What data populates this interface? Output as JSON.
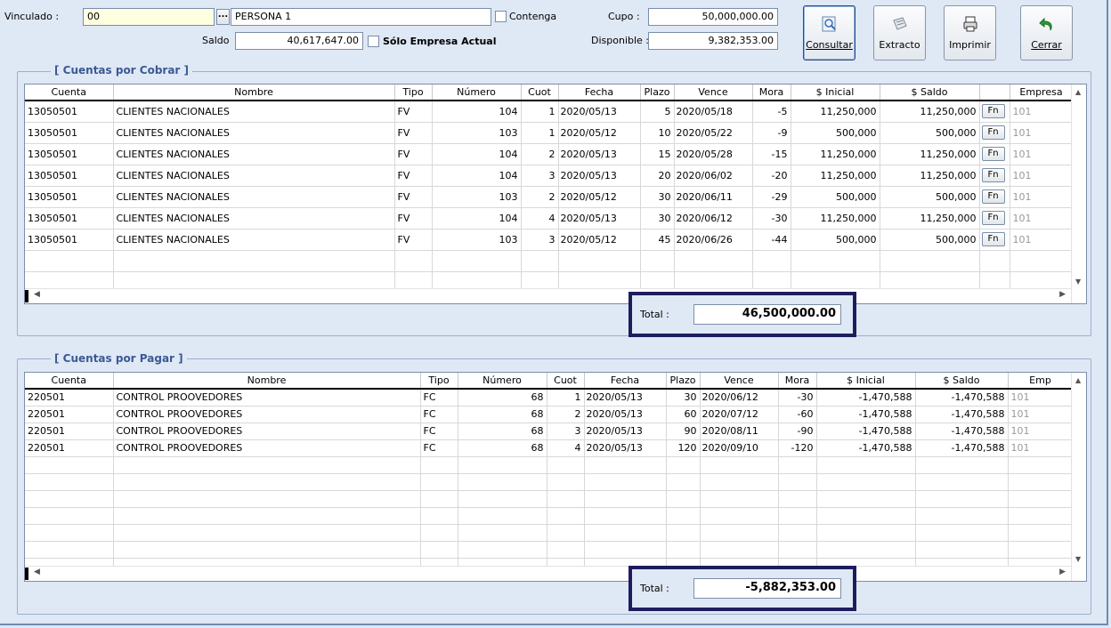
{
  "header": {
    "vinculado_label": "Vinculado :",
    "vinculado_value": "00",
    "dots_label": "...",
    "persona_value": "PERSONA 1",
    "contenga_label": "Contenga",
    "saldo_label": "Saldo",
    "saldo_value": "40,617,647.00",
    "solo_empresa_label": "Sólo Empresa Actual",
    "cupo_label": "Cupo :",
    "cupo_value": "50,000,000.00",
    "disponible_label": "Disponible :",
    "disponible_value": "9,382,353.00"
  },
  "toolbar": {
    "consultar": "Consultar",
    "extracto": "Extracto",
    "imprimir": "Imprimir",
    "cerrar": "Cerrar"
  },
  "cobrar": {
    "title": "[ Cuentas por Cobrar ]",
    "columns": [
      "Cuenta",
      "Nombre",
      "Tipo",
      "Número",
      "Cuot",
      "Fecha",
      "Plazo",
      "Vence",
      "Mora",
      "$ Inicial",
      "$ Saldo",
      "",
      "Empresa"
    ],
    "rows": [
      {
        "cuenta": "13050501",
        "nombre": "CLIENTES NACIONALES",
        "tipo": "FV",
        "numero": "104",
        "cuot": "1",
        "fecha": "2020/05/13",
        "plazo": "5",
        "vence": "2020/05/18",
        "mora": "-5",
        "inicial": "11,250,000",
        "saldo": "11,250,000",
        "fn": "Fn",
        "empresa": "101"
      },
      {
        "cuenta": "13050501",
        "nombre": "CLIENTES NACIONALES",
        "tipo": "FV",
        "numero": "103",
        "cuot": "1",
        "fecha": "2020/05/12",
        "plazo": "10",
        "vence": "2020/05/22",
        "mora": "-9",
        "inicial": "500,000",
        "saldo": "500,000",
        "fn": "Fn",
        "empresa": "101"
      },
      {
        "cuenta": "13050501",
        "nombre": "CLIENTES NACIONALES",
        "tipo": "FV",
        "numero": "104",
        "cuot": "2",
        "fecha": "2020/05/13",
        "plazo": "15",
        "vence": "2020/05/28",
        "mora": "-15",
        "inicial": "11,250,000",
        "saldo": "11,250,000",
        "fn": "Fn",
        "empresa": "101"
      },
      {
        "cuenta": "13050501",
        "nombre": "CLIENTES NACIONALES",
        "tipo": "FV",
        "numero": "104",
        "cuot": "3",
        "fecha": "2020/05/13",
        "plazo": "20",
        "vence": "2020/06/02",
        "mora": "-20",
        "inicial": "11,250,000",
        "saldo": "11,250,000",
        "fn": "Fn",
        "empresa": "101"
      },
      {
        "cuenta": "13050501",
        "nombre": "CLIENTES NACIONALES",
        "tipo": "FV",
        "numero": "103",
        "cuot": "2",
        "fecha": "2020/05/12",
        "plazo": "30",
        "vence": "2020/06/11",
        "mora": "-29",
        "inicial": "500,000",
        "saldo": "500,000",
        "fn": "Fn",
        "empresa": "101"
      },
      {
        "cuenta": "13050501",
        "nombre": "CLIENTES NACIONALES",
        "tipo": "FV",
        "numero": "104",
        "cuot": "4",
        "fecha": "2020/05/13",
        "plazo": "30",
        "vence": "2020/06/12",
        "mora": "-30",
        "inicial": "11,250,000",
        "saldo": "11,250,000",
        "fn": "Fn",
        "empresa": "101"
      },
      {
        "cuenta": "13050501",
        "nombre": "CLIENTES NACIONALES",
        "tipo": "FV",
        "numero": "103",
        "cuot": "3",
        "fecha": "2020/05/12",
        "plazo": "45",
        "vence": "2020/06/26",
        "mora": "-44",
        "inicial": "500,000",
        "saldo": "500,000",
        "fn": "Fn",
        "empresa": "101"
      }
    ],
    "total_label": "Total :",
    "total_value": "46,500,000.00"
  },
  "pagar": {
    "title": "[ Cuentas por Pagar ]",
    "columns": [
      "Cuenta",
      "Nombre",
      "Tipo",
      "Número",
      "Cuot",
      "Fecha",
      "Plazo",
      "Vence",
      "Mora",
      "$ Inicial",
      "$ Saldo",
      "Emp"
    ],
    "rows": [
      {
        "cuenta": "220501",
        "nombre": "CONTROL PROOVEDORES",
        "tipo": "FC",
        "numero": "68",
        "cuot": "1",
        "fecha": "2020/05/13",
        "plazo": "30",
        "vence": "2020/06/12",
        "mora": "-30",
        "inicial": "-1,470,588",
        "saldo": "-1,470,588",
        "empresa": "101"
      },
      {
        "cuenta": "220501",
        "nombre": "CONTROL PROOVEDORES",
        "tipo": "FC",
        "numero": "68",
        "cuot": "2",
        "fecha": "2020/05/13",
        "plazo": "60",
        "vence": "2020/07/12",
        "mora": "-60",
        "inicial": "-1,470,588",
        "saldo": "-1,470,588",
        "empresa": "101"
      },
      {
        "cuenta": "220501",
        "nombre": "CONTROL PROOVEDORES",
        "tipo": "FC",
        "numero": "68",
        "cuot": "3",
        "fecha": "2020/05/13",
        "plazo": "90",
        "vence": "2020/08/11",
        "mora": "-90",
        "inicial": "-1,470,588",
        "saldo": "-1,470,588",
        "empresa": "101"
      },
      {
        "cuenta": "220501",
        "nombre": "CONTROL PROOVEDORES",
        "tipo": "FC",
        "numero": "68",
        "cuot": "4",
        "fecha": "2020/05/13",
        "plazo": "120",
        "vence": "2020/09/10",
        "mora": "-120",
        "inicial": "-1,470,588",
        "saldo": "-1,470,588",
        "empresa": "101"
      }
    ],
    "total_label": "Total :",
    "total_value": "-5,882,353.00"
  },
  "colors": {
    "window_bg": "#dfe8f5",
    "group_title": "#3a5a94",
    "highlight_border": "#1d1d5e",
    "field_yellow": "#fefee0"
  }
}
